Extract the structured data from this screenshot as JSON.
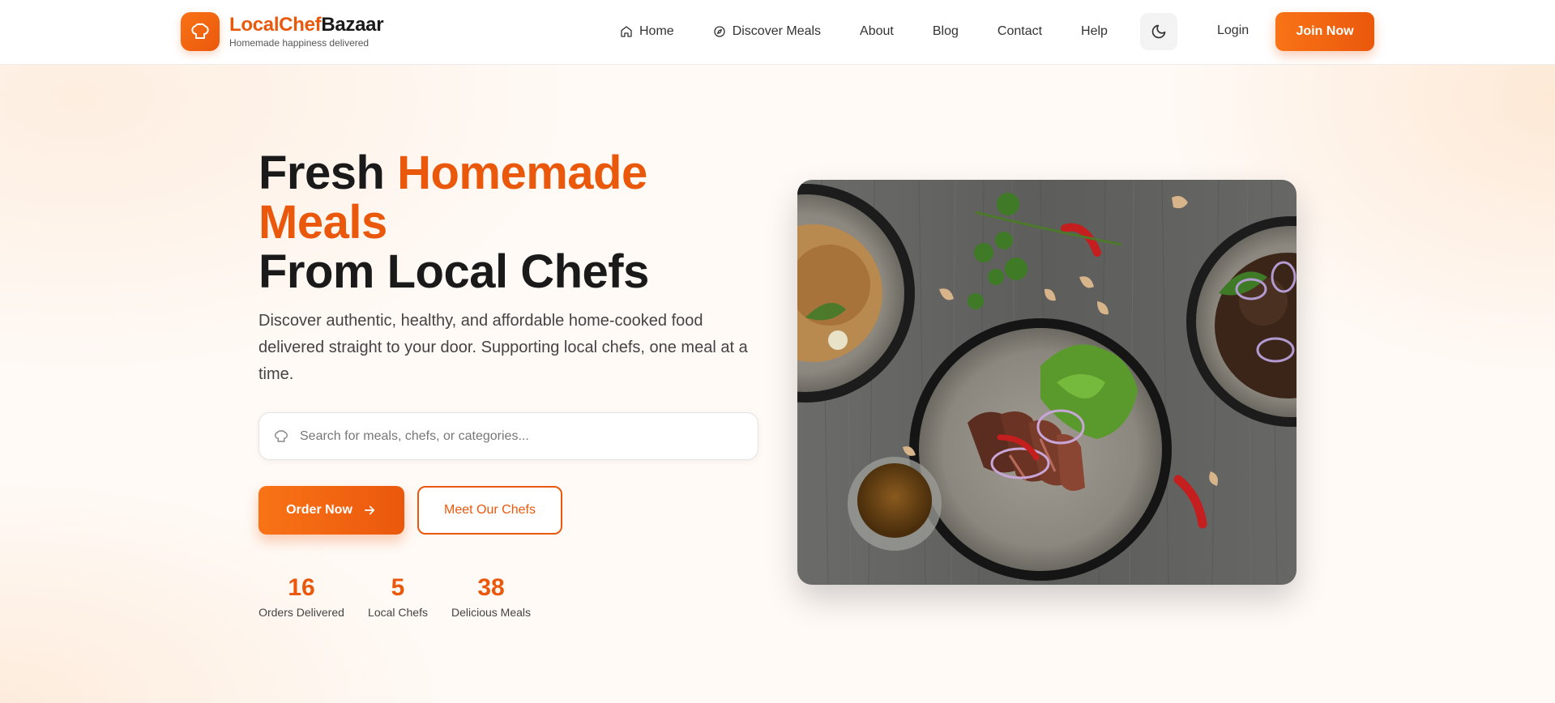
{
  "header": {
    "brand": {
      "name_part1": "LocalChef",
      "name_part2": "Bazaar",
      "tagline": "Homemade happiness delivered",
      "logo_icon": "chef-hat-icon"
    },
    "nav": [
      {
        "label": "Home",
        "icon": "home-icon"
      },
      {
        "label": "Discover Meals",
        "icon": "compass-icon"
      },
      {
        "label": "About"
      },
      {
        "label": "Blog"
      },
      {
        "label": "Contact"
      },
      {
        "label": "Help"
      }
    ],
    "theme_toggle_icon": "moon-icon",
    "login_label": "Login",
    "join_label": "Join Now"
  },
  "hero": {
    "headline_1": "Fresh ",
    "headline_highlight": "Homemade Meals",
    "headline_2": "From Local Chefs",
    "subtitle": "Discover authentic, healthy, and affordable home-cooked food delivered straight to your door. Supporting local chefs, one meal at a time.",
    "search": {
      "placeholder": "Search for meals, chefs, or categories...",
      "value": "",
      "icon": "chef-hat-icon"
    },
    "order_label": "Order Now",
    "order_icon": "arrow-right-icon",
    "chefs_label": "Meet Our Chefs",
    "stats": [
      {
        "value": "16",
        "label": "Orders Delivered"
      },
      {
        "value": "5",
        "label": "Local Chefs"
      },
      {
        "value": "38",
        "label": "Delicious Meals"
      }
    ]
  },
  "colors": {
    "accent": "#ea580c",
    "accent_light": "#f97316",
    "text_dark": "#1a1a1a"
  }
}
